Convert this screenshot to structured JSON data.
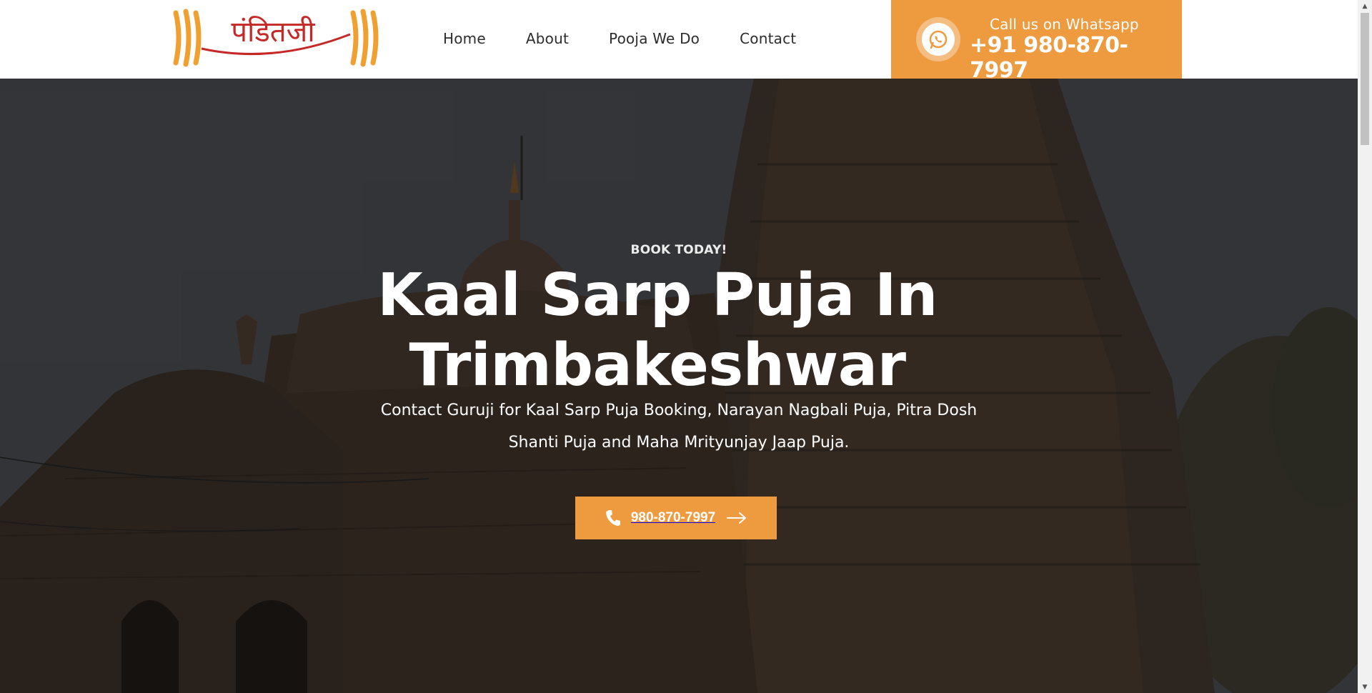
{
  "header": {
    "logo_text": "पंडितजी",
    "nav": [
      {
        "label": "Home"
      },
      {
        "label": "About"
      },
      {
        "label": "Pooja We Do"
      },
      {
        "label": "Contact"
      }
    ],
    "whatsapp": {
      "label": "Call us on Whatsapp",
      "number": "+91 980-870-7997",
      "icon": "whatsapp-icon"
    }
  },
  "hero": {
    "kicker": "BOOK TODAY!",
    "headline": "Kaal Sarp Puja In Trimbakeshwar",
    "subtext": "Contact Guruji for Kaal Sarp Puja Booking, Narayan Nagbali Puja, Pitra Dosh Shanti Puja and Maha Mrityunjay Jaap Puja.",
    "cta": {
      "label": "980-870-7997",
      "icon_left": "phone-icon",
      "icon_right": "arrow-right-icon"
    },
    "background": "temple-photo"
  },
  "colors": {
    "accent": "#ee9a3f",
    "logo_red": "#c62828",
    "logo_orange": "#f0a030",
    "header_bg": "#ffffff",
    "nav_text": "#2c2c2c"
  }
}
